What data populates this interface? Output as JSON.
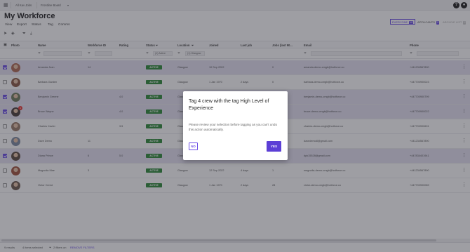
{
  "topbar": {
    "tabs": [
      "All Kav Jobs",
      "Frontline Board"
    ],
    "help_icon": "?",
    "account_icon": "user"
  },
  "page": {
    "title": "My Workforce"
  },
  "menu": [
    "View",
    "Export",
    "Status",
    "Tag",
    "Comms"
  ],
  "segments": [
    {
      "label": "EVERYONE",
      "count": "10",
      "state": "active"
    },
    {
      "label": "APPLICANTS",
      "count": "3",
      "state": "normal"
    },
    {
      "label": "ARCHIVE LIST",
      "count": "0",
      "state": "dim"
    }
  ],
  "columns": [
    "Photo",
    "Name",
    "Workforce ID",
    "Rating",
    "Status",
    "Location",
    "Joined",
    "Last job",
    "Jobs (last 90...",
    "Email",
    "Phone"
  ],
  "filters": {
    "status": "(1) Active",
    "location": "(1) Glasgow"
  },
  "rows": [
    {
      "selected": true,
      "name": "Amanda Jean",
      "id": "14",
      "rating": "",
      "status": "ACTIVE",
      "location": "Glasgow",
      "joined": "10 Sep 2022",
      "last_job": "",
      "jobs": "0",
      "email": "amanda-demo-cmgb@hotforce.co",
      "phone": "+441234567890",
      "avatar_color": "#b06a55",
      "badge": ""
    },
    {
      "selected": false,
      "name": "Barbara Garden",
      "id": "",
      "rating": "",
      "status": "ACTIVE",
      "location": "Glasgow",
      "joined": "1 Jan 1970",
      "last_job": "2 days",
      "jobs": "0",
      "email": "barbara-demo-cmgb@hotforce.co",
      "phone": "+447700900023",
      "avatar_color": "#8a5a44",
      "badge": ""
    },
    {
      "selected": true,
      "name": "Benjamin Greene",
      "id": "",
      "rating": "4.0",
      "status": "ACTIVE",
      "location": "Glasgow",
      "joined": "1 Jan 1970",
      "last_job": "",
      "jobs": "0",
      "email": "benjamin-demo-cmgb@hotforce.co",
      "phone": "+447700900799",
      "avatar_color": "#6e7b5a",
      "badge": ""
    },
    {
      "selected": true,
      "name": "Bruce Wayne",
      "id": "",
      "rating": "4.0",
      "status": "ACTIVE",
      "location": "Glasgow",
      "joined": "10 Sep 2022",
      "last_job": "",
      "jobs": "0",
      "email": "bruce-demo-cmgb@hotforce.co",
      "phone": "+447700900022",
      "avatar_color": "#4a3c3a",
      "badge": "1"
    },
    {
      "selected": false,
      "name": "Charles Xavier",
      "id": "",
      "rating": "3.5",
      "status": "ACTIVE",
      "location": "Glasgow",
      "joined": "1 Jan 1970",
      "last_job": "",
      "jobs": "0",
      "email": "charles-demo-cmgb@hotforce.co",
      "phone": "+447700900601",
      "avatar_color": "#9a7a66",
      "badge": ""
    },
    {
      "selected": false,
      "name": "Dave Demo",
      "id": "11",
      "rating": "",
      "status": "ACTIVE",
      "location": "Glasgow",
      "joined": "1 Jan 1970",
      "last_job": "",
      "jobs": "0",
      "email": "davedemo8@gmail.com",
      "phone": "+441234567890",
      "avatar_color": "#7d8aa0",
      "badge": ""
    },
    {
      "selected": true,
      "name": "Diana Prince",
      "id": "6",
      "rating": "5.0",
      "status": "ACTIVE",
      "location": "Glasgow",
      "joined": "10 Sep 2022",
      "last_job": "",
      "jobs": "0",
      "email": "dpk15528@gmail.com",
      "phone": "+447834401941",
      "avatar_color": "#5a4a3e",
      "badge": ""
    },
    {
      "selected": false,
      "name": "Magnolia Mae",
      "id": "3",
      "rating": "",
      "status": "ACTIVE",
      "location": "Glasgow",
      "joined": "12 Sep 2022",
      "last_job": "4 days",
      "jobs": "1",
      "email": "magnolia-demo-cmgb@hotforce.co",
      "phone": "+441234567890",
      "avatar_color": "#a0523d",
      "badge": ""
    },
    {
      "selected": false,
      "name": "Victor Creed",
      "id": "",
      "rating": "",
      "status": "ACTIVE",
      "location": "Glasgow",
      "joined": "1 Jan 1970",
      "last_job": "2 days",
      "jobs": "28",
      "email": "victor-demo-cmgb@hotforce.co",
      "phone": "+447700900089",
      "avatar_color": "#6c5a4e",
      "badge": ""
    }
  ],
  "modal": {
    "title": "Tag 4 crew with the tag High Level of Experience",
    "body": "Please review your selection before tagging as you can't undo this action automatically.",
    "no_label": "NO",
    "yes_label": "YES"
  },
  "footer": {
    "results": "9 results",
    "selected": "4 items selected",
    "filters": "2 filters on",
    "remove_filters": "REMOVE FILTERS"
  },
  "colors": {
    "accent": "#6b4de6",
    "status_active": "#2e8b3a",
    "selected_row": "#e5e2f3"
  }
}
